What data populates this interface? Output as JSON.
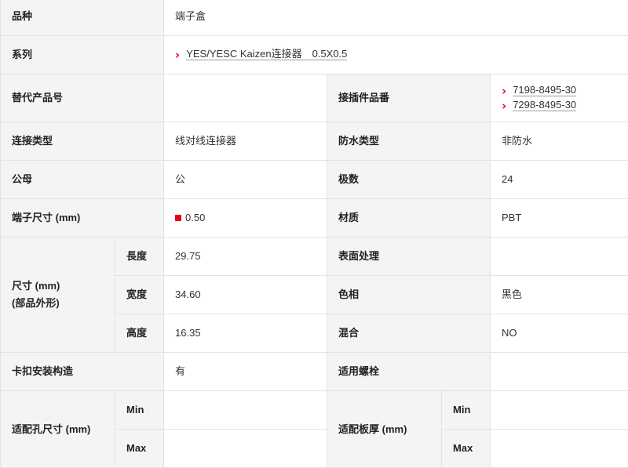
{
  "spec": {
    "product_type": {
      "label": "品种",
      "value": "端子盒"
    },
    "series": {
      "label": "系列",
      "value": "YES/YESC Kaizen连接器　0.5X0.5"
    },
    "substitute": {
      "label": "替代产品号",
      "value": ""
    },
    "mating_part": {
      "label": "接插件品番",
      "values": [
        "7198-8495-30",
        "7298-8495-30"
      ]
    },
    "connection_type": {
      "label": "连接类型",
      "value": "线对线连接器"
    },
    "waterproof_type": {
      "label": "防水类型",
      "value": "非防水"
    },
    "gender": {
      "label": "公母",
      "value": "公"
    },
    "poles": {
      "label": "极数",
      "value": "24"
    },
    "terminal_size": {
      "label": "端子尺寸 (mm)",
      "value": "0.50",
      "swatch_color": "#e60012"
    },
    "material": {
      "label": "材质",
      "value": "PBT"
    },
    "dimensions": {
      "label_line1": "尺寸 (mm)",
      "label_line2": "(部品外形)",
      "length": {
        "label": "長度",
        "value": "29.75"
      },
      "width": {
        "label": "宽度",
        "value": "34.60"
      },
      "height": {
        "label": "高度",
        "value": "16.35"
      }
    },
    "surface_treatment": {
      "label": "表面处理",
      "value": ""
    },
    "color": {
      "label": "色相",
      "value": "黑色"
    },
    "mixed": {
      "label": "混合",
      "value": "NO"
    },
    "snap_structure": {
      "label": "卡扣安装构造",
      "value": "有"
    },
    "screw": {
      "label": "适用螺栓",
      "value": ""
    },
    "hole_size": {
      "label": "适配孔尺寸 (mm)",
      "min_label": "Min",
      "max_label": "Max",
      "min": "",
      "max": ""
    },
    "plate_thickness": {
      "label": "适配板厚 (mm)",
      "min_label": "Min",
      "max_label": "Max",
      "min": "",
      "max": ""
    }
  },
  "colors": {
    "accent": "#e60012",
    "label_bg": "#f4f4f4",
    "border": "#e3e3e3"
  }
}
